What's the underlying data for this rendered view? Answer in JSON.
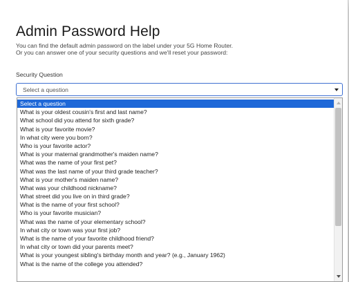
{
  "dialog": {
    "title": "Admin Password Help",
    "intro_line_1": "You can find the default admin password on the label under your 5G Home Router.",
    "intro_line_2": "Or you can answer one of your security questions and we'll reset your password:"
  },
  "security_question": {
    "label": "Security Question",
    "selected_value": "Select a question",
    "options": [
      "Select a question",
      "What is your oldest cousin's first and last name?",
      "What school did you attend for sixth grade?",
      "What is your favorite movie?",
      "In what city were you born?",
      "Who is your favorite actor?",
      "What is your maternal grandmother's maiden name?",
      "What was the name of your first pet?",
      "What was the last name of your third grade teacher?",
      "What is your mother's maiden name?",
      "What was your childhood nickname?",
      "What street did you live on in third grade?",
      "What is the name of your first school?",
      "Who is your favorite musician?",
      "What was the name of your elementary school?",
      "In what city or town was your first job?",
      "What is the name of your favorite childhood friend?",
      "In what city or town did your parents meet?",
      "What is your youngest sibling's birthday month and year? (e.g., January 1962)",
      "What is the name of the college you attended?"
    ]
  },
  "icons": {
    "select_arrow": "chevron-down-icon",
    "scroll_up": "scroll-up-arrow-icon",
    "scroll_down": "scroll-down-arrow-icon"
  },
  "colors": {
    "highlight": "#1e68d8",
    "focus_border": "#3d6fd1"
  }
}
